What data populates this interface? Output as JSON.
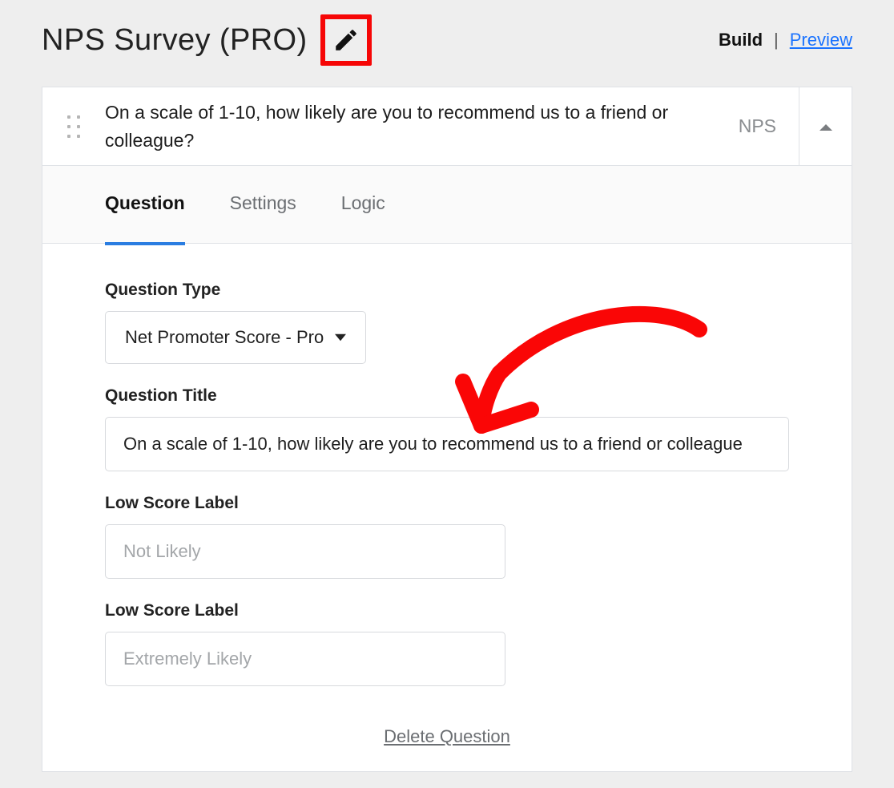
{
  "header": {
    "title": "NPS Survey (PRO)",
    "build_label": "Build",
    "preview_label": "Preview"
  },
  "card": {
    "question_summary": "On a scale of 1-10, how likely are you to recommend us to a friend or colleague?",
    "type_badge": "NPS",
    "tabs": {
      "question": "Question",
      "settings": "Settings",
      "logic": "Logic"
    },
    "fields": {
      "question_type_label": "Question Type",
      "question_type_value": "Net Promoter Score - Pro",
      "question_title_label": "Question Title",
      "question_title_value": "On a scale of 1-10, how likely are you to recommend us to a friend or colleague",
      "low_score_label_1": "Low Score Label",
      "low_score_placeholder_1": "Not Likely",
      "low_score_label_2": "Low Score Label",
      "low_score_placeholder_2": "Extremely Likely"
    },
    "delete_label": "Delete Question"
  }
}
